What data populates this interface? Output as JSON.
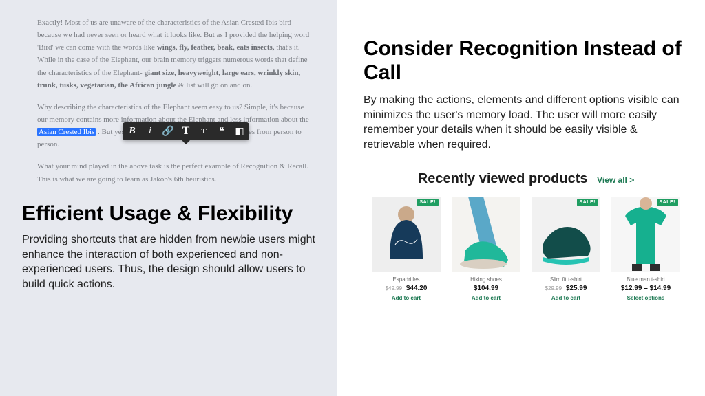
{
  "left": {
    "article": {
      "p1a": "Exactly! Most of us are unaware of the characteristics of the Asian Crested Ibis bird because we had never seen or heard what it looks like. But as I provided the helping word 'Bird' we can come with the words like ",
      "p1b_bold": "wings, fly, feather, beak, eats insects,",
      "p1c": " that's it. While in the case of the Elephant, our brain memory triggers numerous words that define the characteristics of the Elephant- ",
      "p1d_bold": "giant size, heavyweight, large ears, wrinkly skin, trunk, tusks, vegetarian, the African jungle",
      "p1e": " & list will go on and on.",
      "p2a": "Why describing the characteristics of the Elephant seem easy to us? Simple, it's because our memory contains more information about the Elephant and less information about the ",
      "p2_highlight": "Asian Crested Ibis",
      "p2b": ". But yes the availability of the information changes from person to person.",
      "p3": "What your mind played in the above task is the perfect example of Recognition & Recall. This is what we are going to learn as Jakob's 6th heuristics."
    },
    "toolbar": {
      "bold": "B",
      "italic": "i",
      "link": "🔗",
      "bigT": "T",
      "smallT": "T",
      "quote": "❝",
      "more": "◧"
    },
    "heading": "Efficient Usage & Flexibility",
    "body": "Providing shortcuts that are hidden from newbie users might enhance the interaction of both experienced and non-experienced users. Thus, the design should allow users to build quick actions."
  },
  "right": {
    "heading": "Consider Recognition Instead of Call",
    "body": "By making the actions, elements and different options visible can minimizes the user's memory load. The user will more easily remember your details when it should be easily visible & retrievable when required.",
    "products": {
      "title": "Recently viewed products",
      "view_all": "View all >",
      "sale_label": "SALE!",
      "items": [
        {
          "name": "Espadrilles",
          "old": "$49.99",
          "price": "$44.20",
          "cta": "Add to cart",
          "sale": true
        },
        {
          "name": "Hiking shoes",
          "old": "",
          "price": "$104.99",
          "cta": "Add to cart",
          "sale": false
        },
        {
          "name": "Slim fit t-shirt",
          "old": "$29.99",
          "price": "$25.99",
          "cta": "Add to cart",
          "sale": true
        },
        {
          "name": "Blue man t-shirt",
          "old": "",
          "price": "$12.99 – $14.99",
          "cta": "Select options",
          "sale": true
        }
      ]
    }
  }
}
